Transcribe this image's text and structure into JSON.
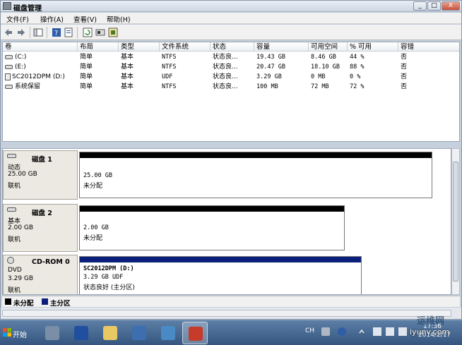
{
  "window": {
    "title": "磁盘管理",
    "minimize": "_",
    "maximize": "□",
    "close": "X"
  },
  "menu": [
    "文件(F)",
    "操作(A)",
    "查看(V)",
    "帮助(H)"
  ],
  "columns": [
    "卷",
    "布局",
    "类型",
    "文件系统",
    "状态",
    "容量",
    "可用空间",
    "% 可用",
    "容错"
  ],
  "volumes": [
    {
      "icon": "drive-icon",
      "name": "(C:)",
      "layout": "简单",
      "type": "基本",
      "fs": "NTFS",
      "status": "状态良...",
      "capacity": "19.43 GB",
      "free": "8.46 GB",
      "pct": "44 %",
      "fault": "否"
    },
    {
      "icon": "drive-icon",
      "name": "(E:)",
      "layout": "简单",
      "type": "基本",
      "fs": "NTFS",
      "status": "状态良...",
      "capacity": "20.47 GB",
      "free": "18.10 GB",
      "pct": "88 %",
      "fault": "否"
    },
    {
      "icon": "cdrom-icon",
      "name": "SC2012DPM (D:)",
      "layout": "简单",
      "type": "基本",
      "fs": "UDF",
      "status": "状态良...",
      "capacity": "3.29 GB",
      "free": "0 MB",
      "pct": "0 %",
      "fault": "否"
    },
    {
      "icon": "drive-icon",
      "name": "系统保留",
      "layout": "简单",
      "type": "基本",
      "fs": "NTFS",
      "status": "状态良...",
      "capacity": "100 MB",
      "free": "72 MB",
      "pct": "72 %",
      "fault": "否"
    }
  ],
  "disks": [
    {
      "name": "磁盘 1",
      "kind": "动态",
      "size": "25.00 GB",
      "state": "联机",
      "part_size": "25.00 GB",
      "part_status": "未分配",
      "part_title": ""
    },
    {
      "name": "磁盘 2",
      "kind": "基本",
      "size": "2.00 GB",
      "state": "联机",
      "part_size": "2.00 GB",
      "part_status": "未分配",
      "part_title": ""
    },
    {
      "name": "CD-ROM 0",
      "kind": "DVD",
      "size": "3.29 GB",
      "state": "联机",
      "part_title": "SC2012DPM  (D:)",
      "part_size": "3.29 GB UDF",
      "part_status": "状态良好 (主分区)"
    }
  ],
  "legend": [
    {
      "label": "未分配",
      "color": "#000000"
    },
    {
      "label": "主分区",
      "color": "#0a1f7a"
    }
  ],
  "taskbar": {
    "start": "开始",
    "lang": "CH",
    "time": "17:36",
    "date": "2014/2/17"
  },
  "watermark": {
    "line1": "运维网",
    "line2": "iyunv.com"
  },
  "colors": {
    "unallocated": "#000000",
    "primary": "#0a1f7a",
    "titlebar": "#cdd7e4"
  }
}
